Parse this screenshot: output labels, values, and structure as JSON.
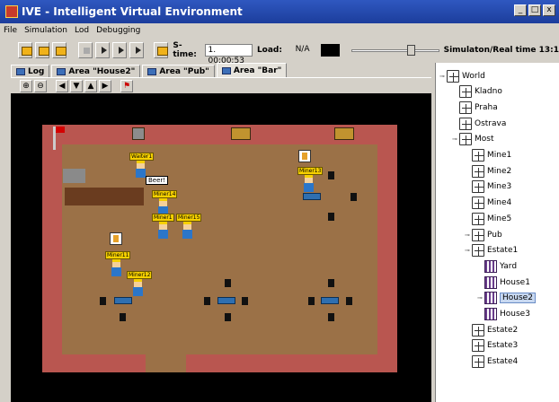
{
  "window": {
    "title": "IVE - Intelligent Virtual Environment",
    "controls": [
      "_",
      "□",
      "x"
    ]
  },
  "menu": {
    "items": [
      "File",
      "Simulation",
      "Lod",
      "Debugging"
    ]
  },
  "toolbar": {
    "stime_label": "S-time:",
    "stime_value": "1. 00:00:53",
    "load_label": "Load:",
    "load_value": "N/A",
    "sim_real_label": "Simulaton/Real time 13:1"
  },
  "tabs": [
    {
      "label": "Log",
      "active": false
    },
    {
      "label": "Area \"House2\"",
      "active": false
    },
    {
      "label": "Area \"Pub\"",
      "active": false
    },
    {
      "label": "Area \"Bar\"",
      "active": true
    }
  ],
  "scene": {
    "speech": "Beer!",
    "npcs": [
      "Waiter1",
      "Miner13",
      "Miner14",
      "Miner1",
      "Miner15",
      "Miner11",
      "Miner12"
    ]
  },
  "tree": {
    "items": [
      {
        "label": "World",
        "indent": 0,
        "icon": "node",
        "toggle": "−"
      },
      {
        "label": "Kladno",
        "indent": 1,
        "icon": "node",
        "toggle": ""
      },
      {
        "label": "Praha",
        "indent": 1,
        "icon": "node",
        "toggle": ""
      },
      {
        "label": "Ostrava",
        "indent": 1,
        "icon": "node",
        "toggle": ""
      },
      {
        "label": "Most",
        "indent": 1,
        "icon": "node",
        "toggle": "−"
      },
      {
        "label": "Mine1",
        "indent": 2,
        "icon": "node",
        "toggle": ""
      },
      {
        "label": "Mine2",
        "indent": 2,
        "icon": "node",
        "toggle": ""
      },
      {
        "label": "Mine3",
        "indent": 2,
        "icon": "node",
        "toggle": ""
      },
      {
        "label": "Mine4",
        "indent": 2,
        "icon": "node",
        "toggle": ""
      },
      {
        "label": "Mine5",
        "indent": 2,
        "icon": "node",
        "toggle": ""
      },
      {
        "label": "Pub",
        "indent": 2,
        "icon": "node",
        "toggle": "+"
      },
      {
        "label": "Estate1",
        "indent": 2,
        "icon": "node",
        "toggle": "−"
      },
      {
        "label": "Yard",
        "indent": 3,
        "icon": "house",
        "toggle": ""
      },
      {
        "label": "House1",
        "indent": 3,
        "icon": "house",
        "toggle": ""
      },
      {
        "label": "House2",
        "indent": 3,
        "icon": "house",
        "toggle": "+",
        "selected": true
      },
      {
        "label": "House3",
        "indent": 3,
        "icon": "house",
        "toggle": ""
      },
      {
        "label": "Estate2",
        "indent": 2,
        "icon": "node",
        "toggle": ""
      },
      {
        "label": "Estate3",
        "indent": 2,
        "icon": "node",
        "toggle": ""
      },
      {
        "label": "Estate4",
        "indent": 2,
        "icon": "node",
        "toggle": ""
      }
    ]
  }
}
